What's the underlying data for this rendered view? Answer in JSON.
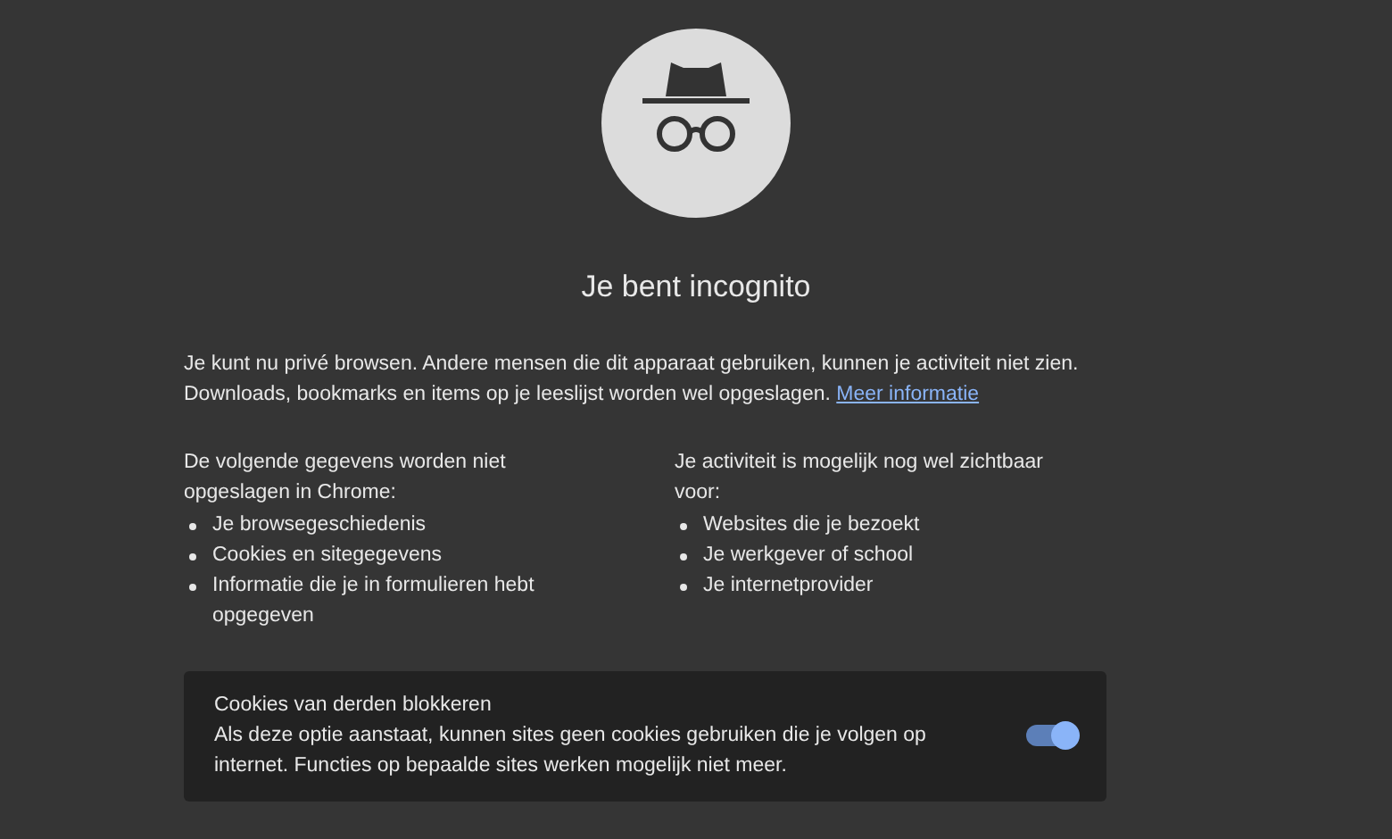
{
  "title": "Je bent incognito",
  "intro": {
    "text": "Je kunt nu privé browsen. Andere mensen die dit apparaat gebruiken, kunnen je activiteit niet zien. Downloads, bookmarks en items op je leeslijst worden wel opgeslagen.",
    "link": "Meer informatie"
  },
  "columns": [
    {
      "heading": "De volgende gegevens worden niet opgeslagen in Chrome:",
      "items": [
        "Je browsegeschiedenis",
        "Cookies en sitegegevens",
        "Informatie die je in formulieren hebt opgegeven"
      ]
    },
    {
      "heading": "Je activiteit is mogelijk nog wel zichtbaar voor:",
      "items": [
        "Websites die je bezoekt",
        "Je werkgever of school",
        "Je internetprovider"
      ]
    }
  ],
  "cookie_card": {
    "title": "Cookies van derden blokkeren",
    "description": "Als deze optie aanstaat, kunnen sites geen cookies gebruiken die je volgen op internet. Functies op bepaalde sites werken mogelijk niet meer.",
    "on": true
  }
}
